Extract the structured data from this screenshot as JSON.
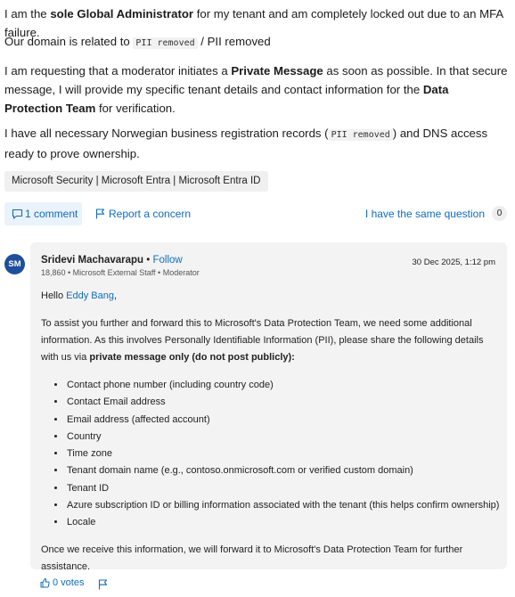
{
  "question": {
    "p1_a": "I am the ",
    "p1_b": "sole Global Administrator",
    "p1_c": " for my tenant and am completely locked out due to an MFA failure.",
    "p2_a": "Our domain is related to ",
    "p2_code": "PII removed",
    "p2_b": " / PII removed",
    "p3_a": "I am requesting that a moderator initiates a ",
    "p3_b": "Private Message",
    "p3_c": " as soon as possible. In that secure message, I will provide my specific tenant details and contact information for the ",
    "p3_d": "Data Protection Team",
    "p3_e": " for verification.",
    "p4_a": "I have all necessary Norwegian business registration records (",
    "p4_code": "PII removed",
    "p4_b": ") and DNS access ready to prove ownership."
  },
  "tags": "Microsoft Security | Microsoft Entra | Microsoft Entra ID",
  "actions": {
    "comment_label": "1 comment",
    "report_label": "Report a concern",
    "same_question_label": "I have the same question",
    "same_question_count": "0"
  },
  "answer": {
    "avatar_initials": "SM",
    "author": "Sridevi Machavarapu",
    "separator": " • ",
    "follow_label": "Follow",
    "meta": "18,860 • Microsoft External Staff • Moderator",
    "date": "30 Dec 2025, 1:12 pm",
    "greeting_a": "Hello ",
    "greeting_name": "Eddy Bang",
    "greeting_b": ",",
    "body_a": "To assist you further and forward this to Microsoft's Data Protection Team, we need some additional information. As this involves Personally Identifiable Information (PII), please share the following details with us via ",
    "body_b": "private message only (do not post publicly):",
    "items": [
      "Contact phone number (including country code)",
      "Contact Email address",
      "Email address (affected account)",
      "Country",
      "Time zone",
      "Tenant domain name (e.g., contoso.onmicrosoft.com or verified custom domain)",
      "Tenant ID",
      "Azure subscription ID or billing information associated with the tenant (this helps confirm ownership)",
      "Locale"
    ],
    "closing": "Once we receive this information, we will forward it to Microsoft's Data Protection Team for further assistance.",
    "votes_label": "0 votes"
  },
  "colors": {
    "link": "#0f6cbd",
    "avatar": "#1f4e9c",
    "answer_bg": "#f3f3f3"
  },
  "icons": [
    "comment-icon",
    "flag-icon",
    "thumbs-up-icon"
  ]
}
